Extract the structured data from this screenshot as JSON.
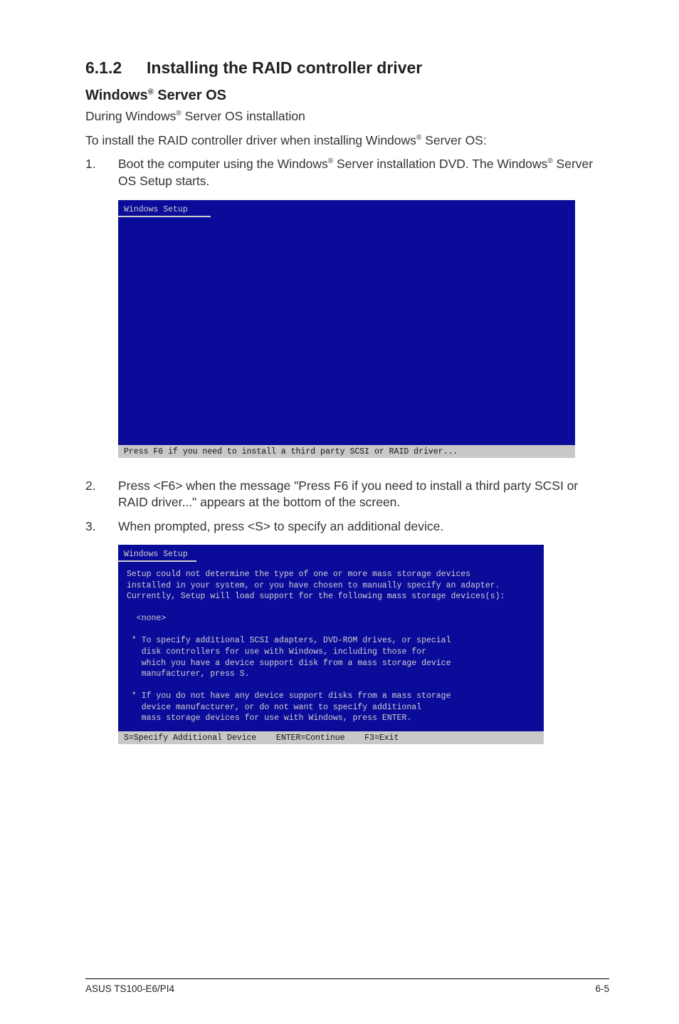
{
  "section": {
    "number": "6.1.2",
    "title": "Installing the RAID controller driver"
  },
  "subhead": {
    "prefix": "Windows",
    "sup": "®",
    "suffix": " Server OS"
  },
  "p1": {
    "a": "During Windows",
    "sup": "®",
    "b": " Server OS installation"
  },
  "p2": {
    "a": "To install the RAID controller driver when installing Windows",
    "sup": "®",
    "b": " Server OS:"
  },
  "step1": {
    "num": "1.",
    "a": "Boot the computer using the Windows",
    "sup1": "®",
    "b": " Server installation DVD. The Windows",
    "sup2": "®",
    "c": " Server OS Setup starts."
  },
  "console1": {
    "title": "Windows Setup",
    "status": "Press F6 if you need to install a third party SCSI or RAID driver..."
  },
  "step2": {
    "num": "2.",
    "text": "Press <F6> when the message \"Press F6 if you need to install a third party SCSI or RAID driver...\" appears at the bottom of the screen."
  },
  "step3": {
    "num": "3.",
    "text": "When prompted, press <S> to specify an additional device."
  },
  "console2": {
    "title": "Windows Setup",
    "body": "Setup could not determine the type of one or more mass storage devices\ninstalled in your system, or you have chosen to manually specify an adapter.\nCurrently, Setup will load support for the following mass storage devices(s):\n\n  <none>\n\n * To specify additional SCSI adapters, DVD-ROM drives, or special\n   disk controllers for use with Windows, including those for\n   which you have a device support disk from a mass storage device\n   manufacturer, press S.\n\n * If you do not have any device support disks from a mass storage\n   device manufacturer, or do not want to specify additional\n   mass storage devices for use with Windows, press ENTER.",
    "status": "S=Specify Additional Device    ENTER=Continue    F3=Exit"
  },
  "footer": {
    "left": "ASUS TS100-E6/PI4",
    "right": "6-5"
  }
}
